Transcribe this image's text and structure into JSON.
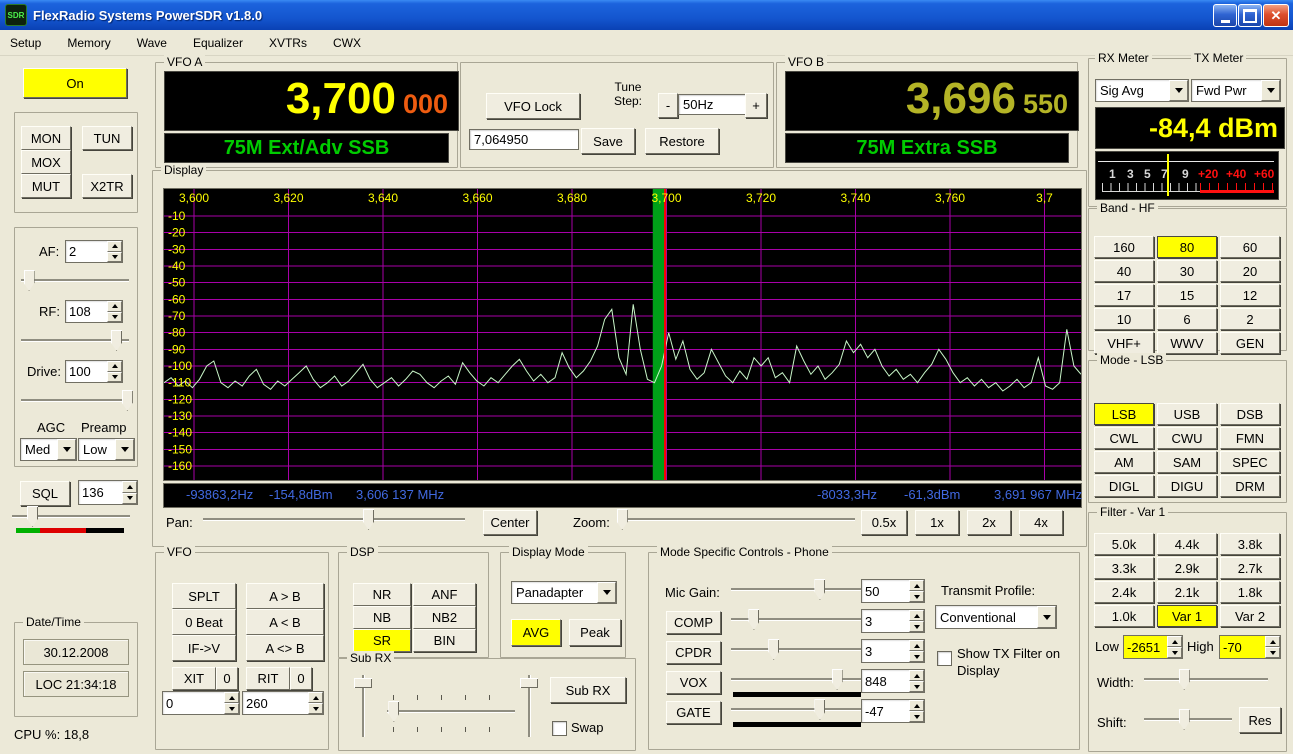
{
  "window": {
    "title": "FlexRadio Systems PowerSDR v1.8.0",
    "icon_label": "SDR"
  },
  "menu": {
    "items": [
      "Setup",
      "Memory",
      "Wave",
      "Equalizer",
      "XVTRs",
      "CWX"
    ]
  },
  "colors": {
    "active_yellow": "#ffff00",
    "display_grid": "#a800a8",
    "spectrum_trace": "#c8f5c8",
    "filter_band_green": "#00a018",
    "carrier_line_red": "#ff0000",
    "axis_label_yellow": "#ffff00",
    "status_text_blue": "#4169e1",
    "vfo_a_digits": "#ffff00",
    "vfo_a_subdigits": "#ee5c10",
    "vfo_b_digits": "#b4b426",
    "band_text_green": "#00cc00",
    "meter_text_yellow": "#ffff00"
  },
  "left": {
    "power": {
      "label": "On"
    },
    "tx_buttons": {
      "mon": "MON",
      "tun": "TUN",
      "mox": "MOX",
      "mut": "MUT",
      "x2tr": "X2TR"
    },
    "af": {
      "label": "AF:",
      "value": "2"
    },
    "rf": {
      "label": "RF:",
      "value": "108"
    },
    "drive": {
      "label": "Drive:",
      "value": "100"
    },
    "agc": {
      "label": "AGC",
      "value": "Med"
    },
    "preamp": {
      "label": "Preamp",
      "value": "Low"
    },
    "sql": {
      "label": "SQL",
      "value": "136"
    },
    "datetime": {
      "title": "Date/Time",
      "date": "30.12.2008",
      "time": "LOC 21:34:18"
    },
    "cpu_label": "CPU %: 18,8"
  },
  "vfo_a": {
    "title": "VFO A",
    "digits": "3,700",
    "sub_digits": "000",
    "band_text": "75M Ext/Adv SSB"
  },
  "vfo_b": {
    "title": "VFO B",
    "digits": "3,696",
    "sub_digits": "550",
    "band_text": "75M Extra SSB"
  },
  "tune": {
    "vfo_lock": "VFO Lock",
    "step_label": "Tune\nStep:",
    "minus": "-",
    "step_value": "50Hz",
    "plus": "+",
    "memory_value": "7,064950",
    "save": "Save",
    "restore": "Restore"
  },
  "meter": {
    "rx_title": "RX Meter",
    "tx_title": "TX Meter",
    "rx_mode": "Sig Avg",
    "tx_mode": "Fwd Pwr",
    "reading": "-84,4 dBm",
    "scale_white": [
      "1",
      "3",
      "5",
      "7",
      "9"
    ],
    "scale_red": [
      "+20",
      "+40",
      "+60"
    ]
  },
  "display": {
    "title": "Display",
    "freq_ticks": [
      "3,600",
      "3,620",
      "3,640",
      "3,660",
      "3,680",
      "3,700",
      "3,720",
      "3,740",
      "3,760",
      "3,7"
    ],
    "db_ticks": [
      "-10",
      "-20",
      "-30",
      "-40",
      "-50",
      "-60",
      "-70",
      "-80",
      "-90",
      "-100",
      "-110",
      "-120",
      "-130",
      "-140",
      "-150",
      "-160"
    ],
    "status_left": [
      "-93863,2Hz",
      "-154,8dBm",
      "3,606 137 MHz"
    ],
    "status_right": [
      "-8033,3Hz",
      "-61,3dBm",
      "3,691 967 MHz"
    ],
    "pan_label": "Pan:",
    "center_button": "Center",
    "zoom_label": "Zoom:",
    "zoom_buttons": [
      "0.5x",
      "1x",
      "2x",
      "4x"
    ],
    "spectrum": {
      "filter_band": {
        "start_frac": 0.533,
        "end_frac": 0.5475
      },
      "points_dbm": [
        -110,
        -107,
        -112,
        -109,
        -113,
        -108,
        -100,
        -97,
        -110,
        -113,
        -109,
        -112,
        -106,
        -102,
        -111,
        -114,
        -109,
        -112,
        -108,
        -104,
        -100,
        -108,
        -113,
        -110,
        -106,
        -112,
        -109,
        -104,
        -99,
        -108,
        -113,
        -110,
        -107,
        -112,
        -108,
        -103,
        -105,
        -110,
        -113,
        -109,
        -106,
        -111,
        -98,
        -104,
        -109,
        -112,
        -107,
        -110,
        -105,
        -100,
        -96,
        -103,
        -109,
        -105,
        -110,
        -107,
        -92,
        -101,
        -107,
        -103,
        -97,
        -88,
        -72,
        -66,
        -95,
        -105,
        -63,
        -90,
        -108,
        -110,
        -100,
        -80,
        -96,
        -85,
        -102,
        -108,
        -104,
        -90,
        -98,
        -106,
        -110,
        -103,
        -108,
        -95,
        -100,
        -95,
        -107,
        -104,
        -110,
        -88,
        -97,
        -105,
        -100,
        -108,
        -104,
        -99,
        -85,
        -92,
        -87,
        -95,
        -90,
        -100,
        -106,
        -102,
        -108,
        -105,
        -110,
        -104,
        -99,
        -90,
        -96,
        -104,
        -110,
        -107,
        -112,
        -108,
        -113,
        -110,
        -115,
        -112,
        -108,
        -113,
        -110,
        -95,
        -112,
        -114,
        -110,
        -78,
        -100,
        -105
      ]
    }
  },
  "band": {
    "title": "Band - HF",
    "active": "80",
    "buttons": [
      "160",
      "80",
      "60",
      "40",
      "30",
      "20",
      "17",
      "15",
      "12",
      "10",
      "6",
      "2",
      "VHF+",
      "WWV",
      "GEN"
    ]
  },
  "mode": {
    "title": "Mode - LSB",
    "active": "LSB",
    "buttons": [
      "LSB",
      "USB",
      "DSB",
      "CWL",
      "CWU",
      "FMN",
      "AM",
      "SAM",
      "SPEC",
      "DIGL",
      "DIGU",
      "DRM"
    ]
  },
  "filter": {
    "title": "Filter - Var 1",
    "active": "Var 1",
    "buttons": [
      "5.0k",
      "4.4k",
      "3.8k",
      "3.3k",
      "2.9k",
      "2.7k",
      "2.4k",
      "2.1k",
      "1.8k",
      "1.0k",
      "Var 1",
      "Var 2"
    ],
    "low_label": "Low",
    "low_value": "-2651",
    "high_label": "High",
    "high_value": "-70",
    "width_label": "Width:",
    "shift_label": "Shift:",
    "res_button": "Res"
  },
  "vfo_panel": {
    "title": "VFO",
    "splt": "SPLT",
    "a_to_b": "A > B",
    "zero_beat": "0 Beat",
    "b_to_a": "A < B",
    "if_to_v": "IF->V",
    "swap_ab": "A <> B",
    "xit": {
      "label": "XIT",
      "clear": "0",
      "value": "0"
    },
    "rit": {
      "label": "RIT",
      "clear": "0",
      "value": "260"
    }
  },
  "dsp": {
    "title": "DSP",
    "active": "SR",
    "nr": "NR",
    "anf": "ANF",
    "nb": "NB",
    "nb2": "NB2",
    "sr": "SR",
    "bin": "BIN"
  },
  "display_mode": {
    "title": "Display Mode",
    "selected": "Panadapter",
    "avg": "AVG",
    "peak": "Peak",
    "active": "AVG"
  },
  "sub_rx": {
    "title": "Sub RX",
    "button": "Sub RX",
    "swap_label": "Swap"
  },
  "phone": {
    "title": "Mode Specific Controls - Phone",
    "mic_label": "Mic Gain:",
    "mic_value": "50",
    "comp": "COMP",
    "comp_value": "3",
    "cpdr": "CPDR",
    "cpdr_value": "3",
    "vox": "VOX",
    "vox_value": "848",
    "gate": "GATE",
    "gate_value": "-47",
    "tx_profile_label": "Transmit Profile:",
    "tx_profile": "Conventional",
    "show_tx_filter_label": "Show TX Filter on Display"
  }
}
